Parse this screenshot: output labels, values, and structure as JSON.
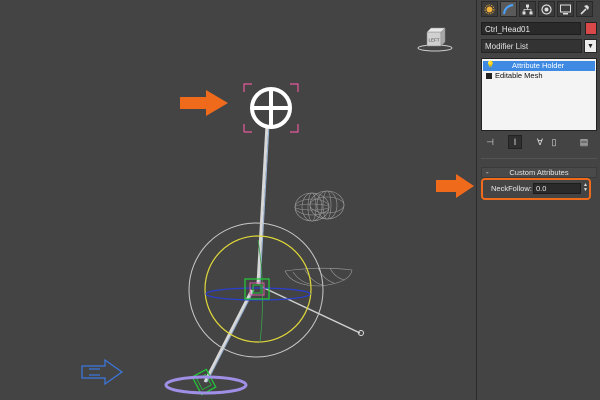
{
  "viewport": {
    "viewcube_label": "LEFT"
  },
  "command_panel": {
    "tabs": [
      {
        "name": "create-tab",
        "icon": "sun-icon"
      },
      {
        "name": "modify-tab",
        "icon": "modify-curve-icon"
      },
      {
        "name": "hierarchy-tab",
        "icon": "hierarchy-icon"
      },
      {
        "name": "motion-tab",
        "icon": "motion-circle-icon"
      },
      {
        "name": "display-tab",
        "icon": "display-monitor-icon"
      },
      {
        "name": "utilities-tab",
        "icon": "hammer-icon"
      }
    ],
    "object_name": "Ctrl_Head01",
    "object_color": "#d94848",
    "modifier_list_label": "Modifier List",
    "stack": [
      {
        "label": "Attribute Holder",
        "selected": true
      },
      {
        "label": "Editable Mesh",
        "selected": false
      }
    ],
    "rollout": {
      "title": "Custom Attributes",
      "collapse_symbol": "-",
      "param_label": "NeckFollow:",
      "param_value": "0.0"
    }
  },
  "annotations": {
    "arrow_color": "#f06a1c",
    "highlight_color": "#f06a1c"
  }
}
